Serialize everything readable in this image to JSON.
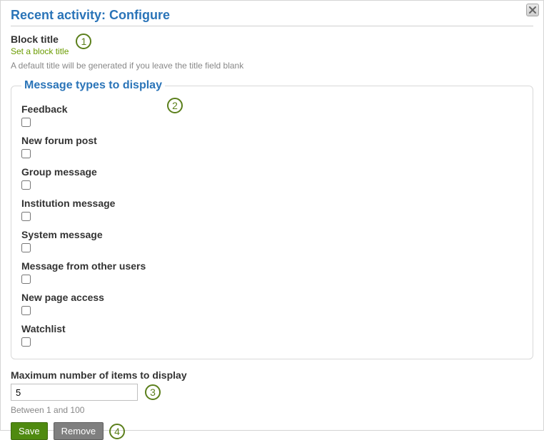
{
  "dialog": {
    "title": "Recent activity: Configure"
  },
  "block_title": {
    "label": "Block title",
    "action_text": "Set a block title",
    "help": "A default title will be generated if you leave the title field blank"
  },
  "message_types": {
    "legend": "Message types to display",
    "items": [
      {
        "label": "Feedback",
        "checked": false
      },
      {
        "label": "New forum post",
        "checked": false
      },
      {
        "label": "Group message",
        "checked": false
      },
      {
        "label": "Institution message",
        "checked": false
      },
      {
        "label": "System message",
        "checked": false
      },
      {
        "label": "Message from other users",
        "checked": false
      },
      {
        "label": "New page access",
        "checked": false
      },
      {
        "label": "Watchlist",
        "checked": false
      }
    ]
  },
  "max_items": {
    "label": "Maximum number of items to display",
    "value": "5",
    "help": "Between 1 and 100"
  },
  "buttons": {
    "save": "Save",
    "remove": "Remove"
  },
  "annotations": {
    "n1": "1",
    "n2": "2",
    "n3": "3",
    "n4": "4"
  }
}
